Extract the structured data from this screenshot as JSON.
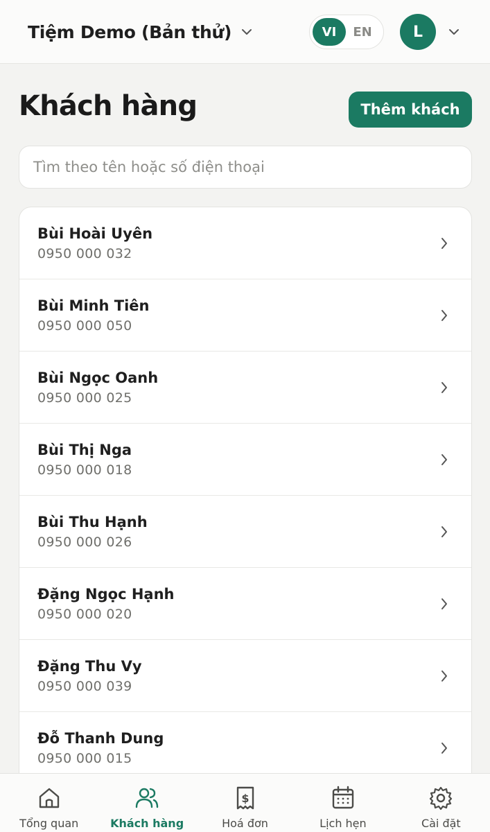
{
  "header": {
    "store_name": "Tiệm Demo (Bản thử)",
    "languages": [
      "VI",
      "EN"
    ],
    "active_language": "VI",
    "avatar_initial": "L"
  },
  "page": {
    "title": "Khách hàng",
    "add_button": "Thêm khách",
    "search_placeholder": "Tìm theo tên hoặc số điện thoại"
  },
  "customers": [
    {
      "name": "Bùi Hoài Uyên",
      "phone": "0950 000 032"
    },
    {
      "name": "Bùi Minh Tiên",
      "phone": "0950 000 050"
    },
    {
      "name": "Bùi Ngọc Oanh",
      "phone": "0950 000 025"
    },
    {
      "name": "Bùi Thị Nga",
      "phone": "0950 000 018"
    },
    {
      "name": "Bùi Thu Hạnh",
      "phone": "0950 000 026"
    },
    {
      "name": "Đặng Ngọc Hạnh",
      "phone": "0950 000 020"
    },
    {
      "name": "Đặng Thu Vy",
      "phone": "0950 000 039"
    },
    {
      "name": "Đỗ Thanh Dung",
      "phone": "0950 000 015"
    }
  ],
  "tabs": [
    {
      "label": "Tổng quan",
      "icon": "home-icon"
    },
    {
      "label": "Khách hàng",
      "icon": "users-icon"
    },
    {
      "label": "Hoá đơn",
      "icon": "receipt-icon"
    },
    {
      "label": "Lịch hẹn",
      "icon": "calendar-icon"
    },
    {
      "label": "Cài đặt",
      "icon": "gear-icon"
    }
  ],
  "colors": {
    "accent": "#1b7a62",
    "background": "#f3f3f1",
    "text_muted": "#6f6f6b"
  }
}
